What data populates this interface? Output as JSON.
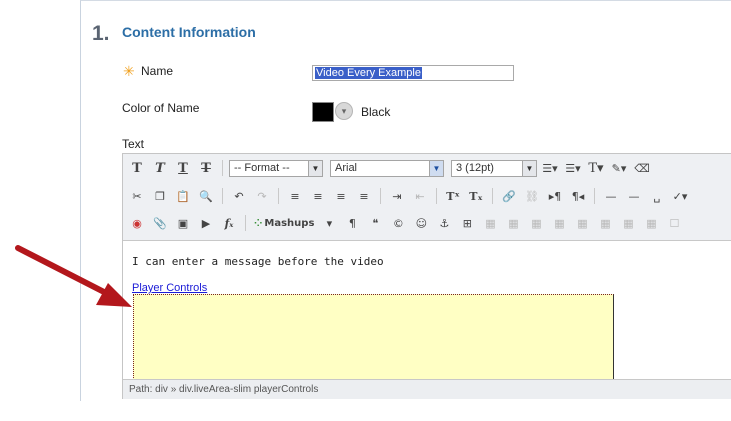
{
  "section": {
    "number": "1.",
    "title": "Content Information"
  },
  "form": {
    "required_marker": "✳",
    "name_label": "Name",
    "name_value": "Video Every Example",
    "color_label": "Color of Name",
    "color_value_text": "Black",
    "color_swatch": "#000000",
    "text_label": "Text"
  },
  "toolbar": {
    "row1": {
      "format_select": "-- Format --",
      "font_select": "Arial",
      "size_select": "3 (12pt)"
    },
    "row3": {
      "mashups": "Mashups"
    }
  },
  "editor": {
    "message": "I can enter a message before the video",
    "link_text": "Player Controls",
    "player_bg": "#ffffc4",
    "path_label": "Path:",
    "path_value": "div » div.liveArea-slim playerControls"
  },
  "arrow_color": "#b3171c"
}
